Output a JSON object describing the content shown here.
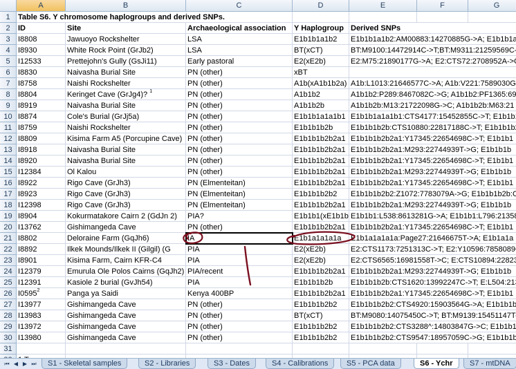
{
  "columns": [
    "A",
    "B",
    "C",
    "D",
    "E",
    "F",
    "G"
  ],
  "selected_column": "A",
  "title": "Table S6. Y chromosome haplogroups and derived SNPs.",
  "headers": [
    "ID",
    "Site",
    "Archaeological association",
    "Y Haplogroup",
    "Derived SNPs"
  ],
  "rows": [
    {
      "n": "3",
      "id": "I8808",
      "site": "Jawuoyo Rockshelter",
      "assoc": "LSA",
      "hap": "E1b1b1a1b2",
      "snps": "E1b1b1a1b2:AM00883:14270885G->A; E1b1b1a"
    },
    {
      "n": "4",
      "id": "I8930",
      "site": "White Rock Point (GrJb2)",
      "assoc": "LSA",
      "hap": "BT(xCT)",
      "snps": "BT:M9100:14472914C->T;BT:M9311:21259569C-"
    },
    {
      "n": "5",
      "id": "I12533",
      "site": "Prettejohn's Gully (GsJi11)",
      "assoc": "Early pastoral",
      "hap": "E2(xE2b)",
      "snps": "E2:M75:21890177G->A; E2:CTS72:2708952A->C;"
    },
    {
      "n": "6",
      "id": "I8830",
      "site": "Naivasha Burial Site",
      "assoc": "PN (other)",
      "hap": "xBT",
      "snps": ""
    },
    {
      "n": "7",
      "id": "I8758",
      "site": "Naishi Rockshelter",
      "assoc": "PN (other)",
      "hap": "A1b(xA1b1b2a)",
      "snps": "A1b:L1013:21646577C->A; A1b:V221:7589030G-"
    },
    {
      "n": "8",
      "id": "I8804",
      "site": "Keringet Cave (GrJg4)?",
      "sup": "1",
      "assoc": "PN (other)",
      "hap": "A1b1b2",
      "snps": "A1b1b2:P289:8467082C->G; A1b1b2:PF1365:690"
    },
    {
      "n": "9",
      "id": "I8919",
      "site": "Naivasha Burial Site",
      "assoc": "PN (other)",
      "hap": "A1b1b2b",
      "snps": "A1b1b2b:M13:21722098G->C; A1b1b2b:M63:21"
    },
    {
      "n": "10",
      "id": "I8874",
      "site": "Cole's Burial (GrJj5a)",
      "assoc": "PN (other)",
      "hap": "E1b1b1a1a1b1",
      "snps": "E1b1b1a1a1b1:CTS4177:15452855C->T; E1b1b1"
    },
    {
      "n": "11",
      "id": "I8759",
      "site": "Naishi Rockshelter",
      "assoc": "PN (other)",
      "hap": "E1b1b1b2b",
      "snps": "E1b1b1b2b:CTS10880:22817188C->T; E1b1b1b2"
    },
    {
      "n": "12",
      "id": "I8809",
      "site": "Kisima Farm A5 (Porcupine Cave)",
      "assoc": "PN (other)",
      "hap": "E1b1b1b2b2a1",
      "snps": "E1b1b1b2b2a1:Y17345:22654698C->T; E1b1b1"
    },
    {
      "n": "13",
      "id": "I8918",
      "site": "Naivasha Burial Site",
      "assoc": "PN (other)",
      "hap": "E1b1b1b2b2a1",
      "snps": "E1b1b1b2b2a1:M293:22744939T->G; E1b1b1b"
    },
    {
      "n": "14",
      "id": "I8920",
      "site": "Naivasha Burial Site",
      "assoc": "PN (other)",
      "hap": "E1b1b1b2b2a1",
      "snps": "E1b1b1b2b2a1:Y17345:22654698C->T; E1b1b1"
    },
    {
      "n": "15",
      "id": "I12384",
      "site": "Ol Kalou",
      "assoc": "PN (other)",
      "hap": "E1b1b1b2b2a1",
      "snps": "E1b1b1b2b2a1:M293:22744939T->G; E1b1b1b"
    },
    {
      "n": "16",
      "id": "I8922",
      "site": "Rigo Cave (GrJh3)",
      "assoc": "PN (Elmenteitan)",
      "hap": "E1b1b1b2b2a1",
      "snps": "E1b1b1b2b2a1:Y17345:22654698C->T; E1b1b1"
    },
    {
      "n": "17",
      "id": "I8923",
      "site": "Rigo Cave (GrJh3)",
      "assoc": "PN (Elmenteitan)",
      "hap": "E1b1b1b2b2",
      "snps": "E1b1b1b2b2:Z1072:7783079A->G; E1b1b1b2b:C"
    },
    {
      "n": "18",
      "id": "I12398",
      "site": "Rigo Cave (GrJh3)",
      "assoc": "PN (Elmenteitan)",
      "hap": "E1b1b1b2b2a1",
      "snps": "E1b1b1b2b2a1:M293:22744939T->G; E1b1b1b"
    },
    {
      "n": "19",
      "id": "I8904",
      "site": "Kokurmatakore Cairn 2 (GdJn 2)",
      "assoc": "PIA?",
      "hap": "E1b1b1(xE1b1b",
      "snps": "E1b1b1:L538:8613281G->A; E1b1b1:L796:21358"
    },
    {
      "n": "20",
      "id": "I13762",
      "site": "Gishimangeda Cave",
      "assoc": "PN (other)",
      "hap": "E1b1b1b2b2a1",
      "snps": "E1b1b1b2b2a1:Y17345:22654698C->T; E1b1b1"
    },
    {
      "n": "21",
      "id": "I8802",
      "site": "Deloraine Farm (GqJh6)",
      "assoc": "IA",
      "hap": "E1b1a1a1a1a",
      "snps": "E1b1a1a1a1a:Page27:21646675T->A; E1b1a1a"
    },
    {
      "n": "22",
      "id": "I8892",
      "site": "Ilkek Mounds/Ilkek II (Gilgil) (G",
      "assoc": "PIA",
      "hap": "E2(xE2b)",
      "snps": "E2:CTS1173:7251313C->T; E2:Y10596:7858089G-"
    },
    {
      "n": "23",
      "id": "I8901",
      "site": "Kisima Farm, Cairn KFR-C4",
      "assoc": "PIA",
      "hap": "E2(xE2b)",
      "snps": "E2:CTS6565:16981558T->C; E:CTS10894:2282337"
    },
    {
      "n": "24",
      "id": "I12379",
      "site": "Emurula Ole Polos Cairns (GqJh2)",
      "assoc": "PIA/recent",
      "hap": "E1b1b1b2b2a1",
      "snps": "E1b1b1b2b2a1:M293:22744939T->G; E1b1b1b"
    },
    {
      "n": "25",
      "id": "I12391",
      "site": "Kasiole 2 burial (GvJh54)",
      "assoc": "PIA",
      "hap": "E1b1b1b2b",
      "snps": "E1b1b1b2b:CTS1620:13992247C->T; E:L504:2138"
    },
    {
      "n": "26",
      "id": "I0595",
      "idsup": "2",
      "site": "Panga ya Saidi",
      "assoc": "Kenya 400BP",
      "hap": "E1b1b1b2b2a1",
      "snps": "E1b1b1b2b2a1:Y17345:22654698C->T; E1b1b1"
    },
    {
      "n": "27",
      "id": "I13977",
      "site": "Gishimangeda Cave",
      "assoc": "PN (other)",
      "hap": "E1b1b1b2b2",
      "snps": "E1b1b1b2b2:CTS4920:15903564G->A; E1b1b1b2"
    },
    {
      "n": "28",
      "id": "I13983",
      "site": "Gishimangeda Cave",
      "assoc": "PN (other)",
      "hap": "BT(xCT)",
      "snps": "BT:M9080:14075450C->T; BT:M9139:15451147T-"
    },
    {
      "n": "29",
      "id": "I13972",
      "site": "Gishimangeda Cave",
      "assoc": "PN (other)",
      "hap": "E1b1b1b2b2",
      "snps": "E1b1b1b2b2:CTS3288^:14803847G->C; E1b1b1b"
    },
    {
      "n": "30",
      "id": "I13980",
      "site": "Gishimangeda Cave",
      "assoc": "PN (other)",
      "hap": "E1b1b1b2b2",
      "snps": "E1b1b1b2b2:CTS9547:18957059C->G; E1b1b1b2"
    }
  ],
  "trailing_rows": [
    "31",
    "32"
  ],
  "row32_fragment": "1 T",
  "tabs": [
    {
      "label": "S1 - Skeletal samples",
      "active": false
    },
    {
      "label": "S2 - Libraries",
      "active": false
    },
    {
      "label": "S3 - Dates",
      "active": false
    },
    {
      "label": "S4 - Calibrations",
      "active": false
    },
    {
      "label": "S5 - PCA data",
      "active": false
    },
    {
      "label": "S6 - Ychr",
      "active": true
    },
    {
      "label": "S7 - mtDNA",
      "active": false
    }
  ],
  "nav_icons": [
    "first-sheet-icon",
    "prev-sheet-icon",
    "next-sheet-icon",
    "last-sheet-icon"
  ],
  "colors": {
    "grid": "#d0d7e5",
    "header_bg": "#dde6f1",
    "ink": "#7a1020",
    "tab_bar": "#dfe8f4"
  }
}
